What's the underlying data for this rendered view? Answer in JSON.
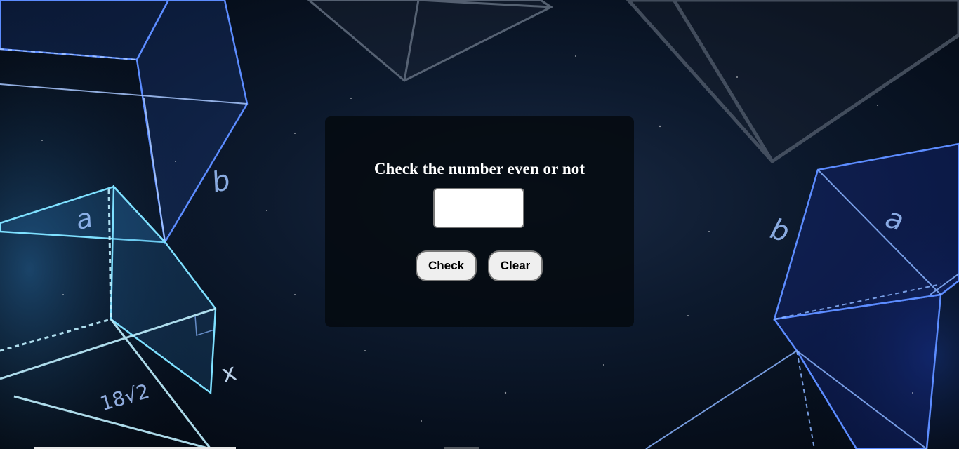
{
  "app": {
    "title": "Check the number even or not"
  },
  "form": {
    "number_value": "",
    "number_placeholder": ""
  },
  "buttons": {
    "check_label": "Check",
    "clear_label": "Clear"
  },
  "background": {
    "math_labels": [
      "a",
      "b",
      "b",
      "a",
      "x",
      "18√2"
    ]
  },
  "colors": {
    "card_background": "#05090f",
    "title_text": "#ffffff",
    "button_background": "#efefef",
    "line_glow": "#4a8cff"
  }
}
